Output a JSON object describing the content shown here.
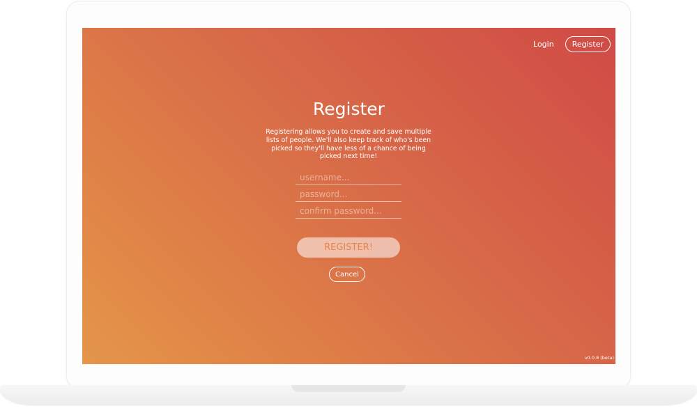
{
  "nav": {
    "login_label": "Login",
    "register_label": "Register"
  },
  "main": {
    "title": "Register",
    "description": "Registering allows you to create and save multiple lists of people. We'll also keep track of who's been picked so they'll have less of a chance of being picked next time!"
  },
  "form": {
    "username": {
      "value": "",
      "placeholder": "username..."
    },
    "password": {
      "value": "",
      "placeholder": "password..."
    },
    "confirm_password": {
      "value": "",
      "placeholder": "confirm password..."
    },
    "submit_label": "REGISTER!",
    "cancel_label": "Cancel"
  },
  "footer": {
    "version": "v0.0.8 (beta)"
  },
  "colors": {
    "gradient_top_right": "#d04a46",
    "gradient_bottom_left": "#e5964a",
    "submit_text": "#e8834a"
  }
}
